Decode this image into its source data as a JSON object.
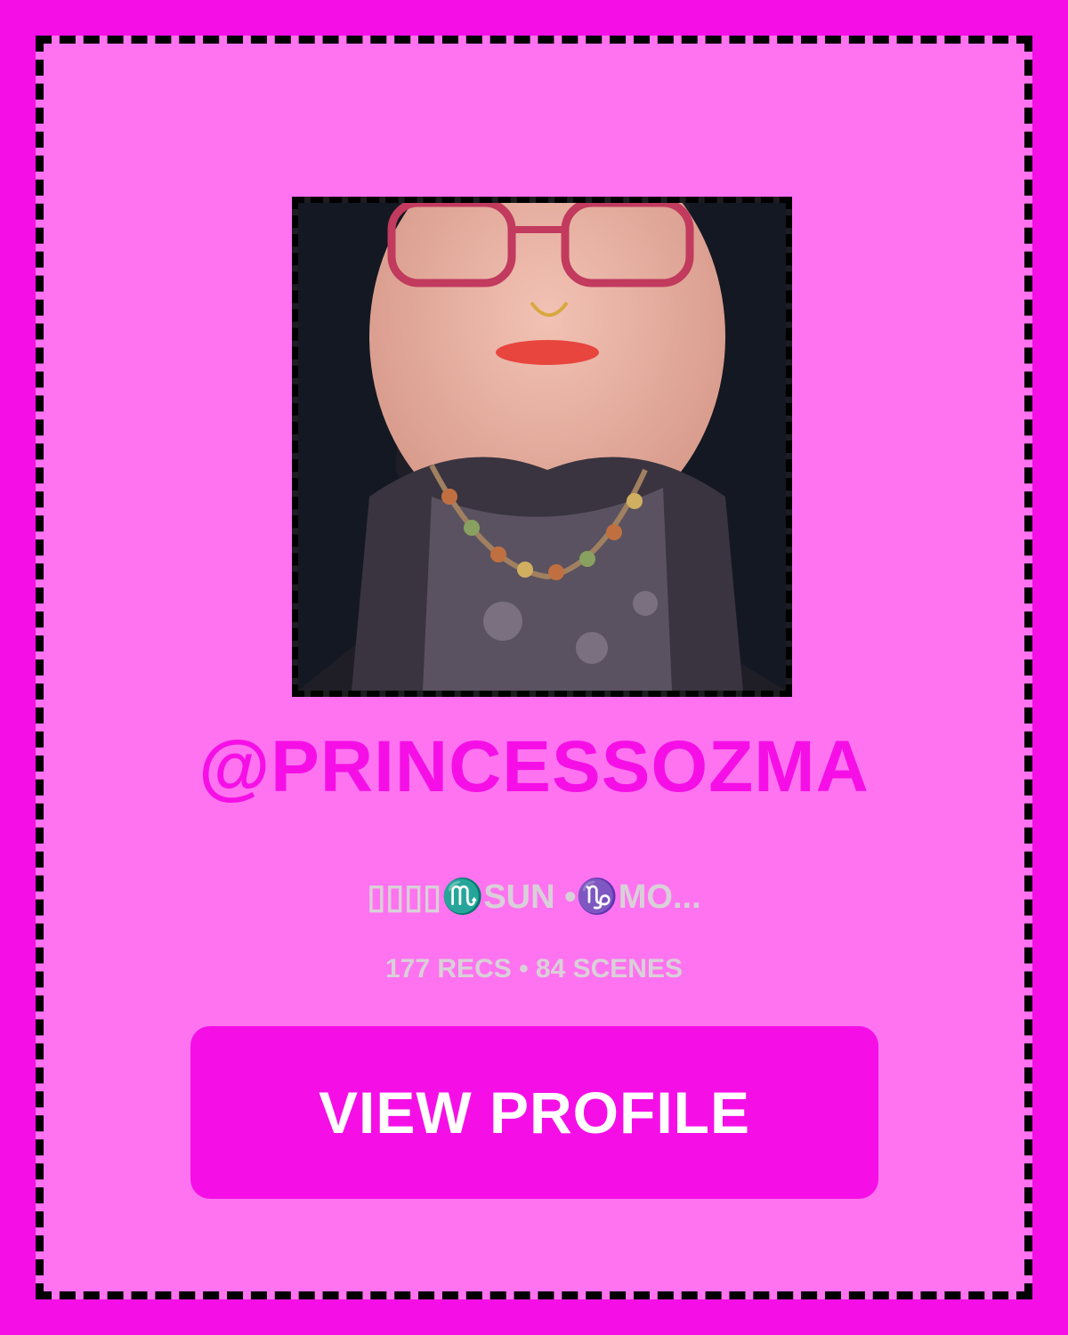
{
  "profile": {
    "username": "@PRINCESSOZMA",
    "bio": "▯▯▯▯♏SUN •♑MO...",
    "stats": "177 RECS • 84 SCENES",
    "photo_icon": "profile-photo"
  },
  "actions": {
    "view_profile_label": "VIEW PROFILE"
  },
  "colors": {
    "background": "#f50fe6",
    "card": "#ff73f0",
    "accent": "#f50fe6",
    "muted_text": "#d8d0d8",
    "button_text": "#ffffff"
  }
}
